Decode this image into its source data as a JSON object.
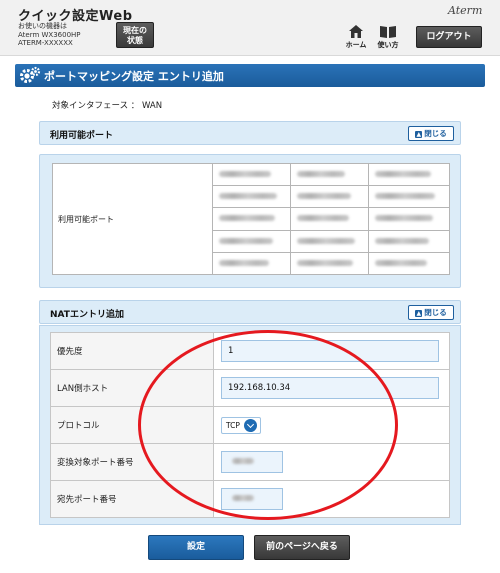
{
  "header": {
    "app_title": "クイック設定Web",
    "device_lines": [
      "お使いの機器は",
      "Aterm  WX3600HP",
      "ATERM-XXXXXX"
    ],
    "status_button_lines": [
      "現在の",
      "状態"
    ],
    "brand": "Aterm",
    "nav": {
      "home_label": "ホーム",
      "manual_label": "使い方"
    },
    "logout_label": "ログアウト"
  },
  "page": {
    "title": "ポートマッピング設定 エントリ追加",
    "interface_text": "対象インタフェース ： WAN"
  },
  "available_ports": {
    "section_title": "利用可能ポート",
    "close_label": "閉じる",
    "row_label": "利用可能ポート",
    "rows": 5,
    "cols": 3
  },
  "nat_entry": {
    "section_title": "NATエントリ追加",
    "close_label": "閉じる",
    "fields": {
      "priority": {
        "label": "優先度",
        "value": "1"
      },
      "lan_host": {
        "label": "LAN側ホスト",
        "value": "192.168.10.34"
      },
      "protocol": {
        "label": "プロトコル",
        "value": "TCP"
      },
      "translated_port": {
        "label": "変換対象ポート番号",
        "value": ""
      },
      "destination_port": {
        "label": "宛先ポート番号",
        "value": ""
      }
    }
  },
  "buttons": {
    "set": "設定",
    "back": "前のページへ戻る"
  },
  "colors": {
    "primary_blue": "#1e5f9e",
    "section_bg": "#dcecf8",
    "annotation_red": "#e5191f",
    "dark_button": "#3a3a3a"
  }
}
